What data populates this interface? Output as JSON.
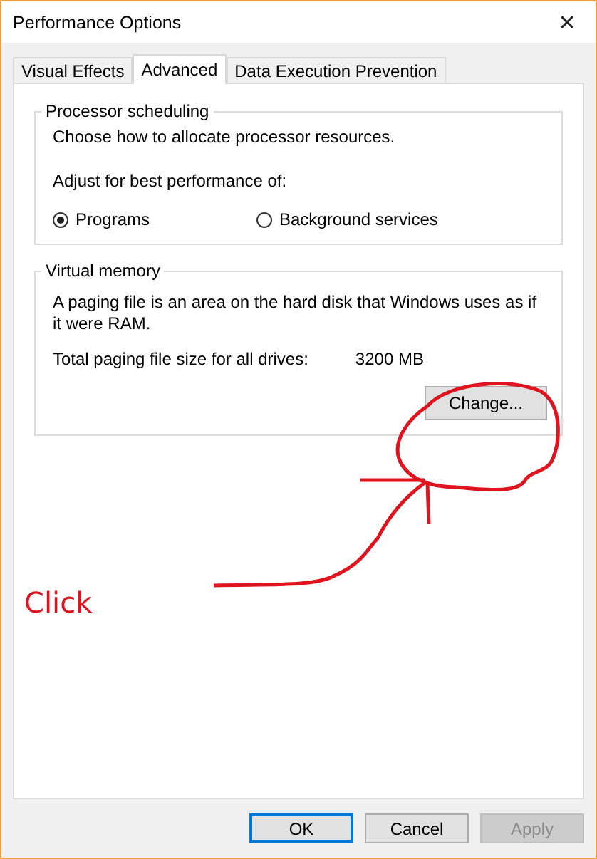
{
  "window": {
    "title": "Performance Options",
    "close": "✕"
  },
  "tabs": [
    {
      "label": "Visual Effects",
      "selected": false
    },
    {
      "label": "Advanced",
      "selected": true
    },
    {
      "label": "Data Execution Prevention",
      "selected": false
    }
  ],
  "processor_scheduling": {
    "title": "Processor scheduling",
    "description": "Choose how to allocate processor resources.",
    "adjust_label": "Adjust for best performance of:",
    "options": [
      {
        "label": "Programs",
        "selected": true
      },
      {
        "label": "Background services",
        "selected": false
      }
    ]
  },
  "virtual_memory": {
    "title": "Virtual memory",
    "description": "A paging file is an area on the hard disk that Windows uses as if it were RAM.",
    "total_label": "Total paging file size for all drives:",
    "total_value": "3200 MB",
    "button": "Change..."
  },
  "annotation": {
    "text": "Click"
  },
  "buttons": [
    {
      "label": "OK",
      "default": true,
      "disabled": false
    },
    {
      "label": "Cancel",
      "default": false,
      "disabled": false
    },
    {
      "label": "Apply",
      "default": false,
      "disabled": true
    }
  ]
}
